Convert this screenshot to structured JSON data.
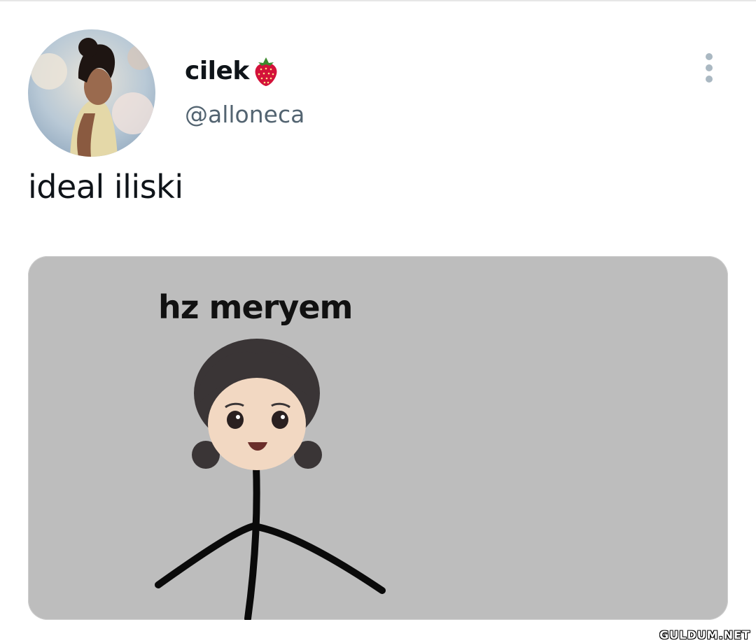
{
  "tweet": {
    "display_name": "cilek",
    "name_emoji_icon": "strawberry-icon",
    "handle": "@alloneca",
    "text": "ideal iliski",
    "more_icon": "more-vertical-icon"
  },
  "media": {
    "caption": "hz meryem",
    "background_color": "#bdbdbd"
  },
  "watermark": "GULDUM.NET"
}
